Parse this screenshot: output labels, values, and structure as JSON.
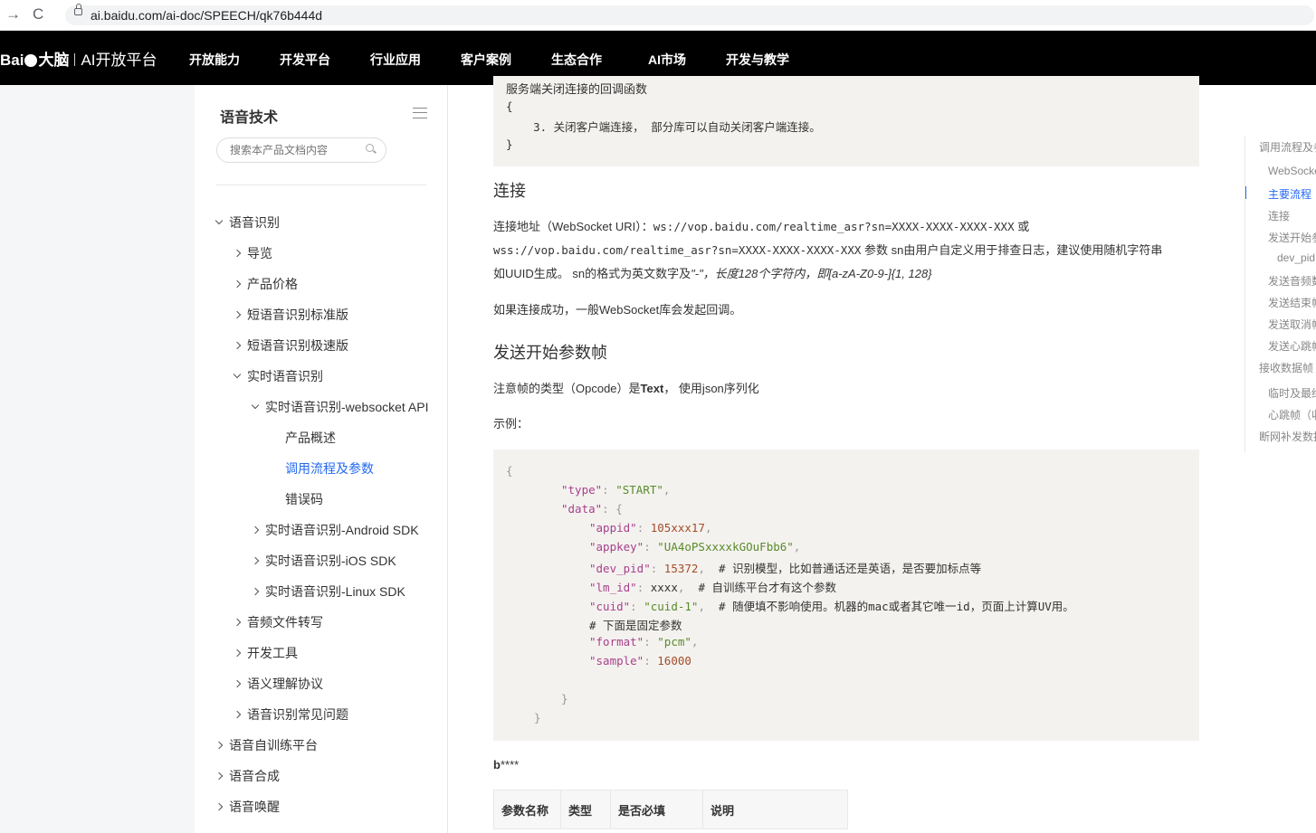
{
  "browser": {
    "url": "ai.baidu.com/ai-doc/SPEECH/qk76b444d",
    "back_icon": "→",
    "reload_icon": "C"
  },
  "topnav": {
    "logo_text": "Bai",
    "logo_text2": "大脑",
    "logo_platform": "AI开放平台",
    "items": [
      "开放能力",
      "开发平台",
      "行业应用",
      "客户案例",
      "生态合作",
      "AI市场",
      "开发与教学"
    ]
  },
  "sidebar": {
    "title": "语音技术",
    "search_placeholder": "搜索本产品文档内容",
    "items": [
      {
        "label": "语音识别"
      },
      {
        "label": "导览"
      },
      {
        "label": "产品价格"
      },
      {
        "label": "短语音识别标准版"
      },
      {
        "label": "短语音识别极速版"
      },
      {
        "label": "实时语音识别"
      },
      {
        "label": "实时语音识别-websocket API"
      },
      {
        "label": "产品概述"
      },
      {
        "label": "调用流程及参数"
      },
      {
        "label": "错误码"
      },
      {
        "label": "实时语音识别-Android SDK"
      },
      {
        "label": "实时语音识别-iOS SDK"
      },
      {
        "label": "实时语音识别-Linux SDK"
      },
      {
        "label": "音频文件转写"
      },
      {
        "label": "开发工具"
      },
      {
        "label": "语义理解协议"
      },
      {
        "label": "语音识别常见问题"
      },
      {
        "label": "语音自训练平台"
      },
      {
        "label": "语音合成"
      },
      {
        "label": "语音唤醒"
      }
    ]
  },
  "content": {
    "top_code": {
      "line1": "服务端关闭连接的回调函数",
      "line2": "{",
      "line3": "    3. 关闭客户端连接， 部分库可以自动关闭客户端连接。",
      "line4": "}"
    },
    "h_connect": "连接",
    "connect_p1_a": "连接地址（WebSocket URI）：",
    "connect_p1_code1": "ws://vop.baidu.com/realtime_asr?sn=XXXX-XXXX-XXXX-XXX",
    "connect_p1_b": " 或",
    "connect_p2_code2": "wss://vop.baidu.com/realtime_asr?sn=XXXX-XXXX-XXXX-XXX",
    "connect_p2_c": " 参数 sn由用户自定义用于排查日志，建议使用随机字符串",
    "connect_p3_a": "如UUID生成。 sn的格式为英文数字及",
    "connect_p3_b": "\"-\"，长度128个字符内，即[a-zA-Z0-9-]{1, 128}",
    "connect_success": "如果连接成功，一般WebSocket库会发起回调。",
    "h_start": "发送开始参数帧",
    "start_note_a": "注意帧的类型（Opcode）是",
    "start_note_b": "Text",
    "start_note_c": "， 使用json序列化",
    "example_label": "示例：",
    "json_example": {
      "open": "{",
      "type_key": "\"type\"",
      "type_val": "\"START\"",
      "data_key": "\"data\"",
      "appid_key": "\"appid\"",
      "appid_val": "105xxx17",
      "appkey_key": "\"appkey\"",
      "appkey_val": "\"UA4oPSxxxxkGOuFbb6\"",
      "devpid_key": "\"dev_pid\"",
      "devpid_val": "15372",
      "devpid_comment": "# 识别模型，比如普通话还是英语，是否要加标点等",
      "lmid_key": "\"lm_id\"",
      "lmid_val": "xxxx",
      "lmid_comment": "# 自训练平台才有这个参数",
      "cuid_key": "\"cuid\"",
      "cuid_val": "\"cuid-1\"",
      "cuid_comment": "# 随便填不影响使用。机器的mac或者其它唯一id，页面上计算UV用。",
      "fixed_comment": "# 下面是固定参数",
      "format_key": "\"format\"",
      "format_val": "\"pcm\"",
      "sample_key": "\"sample\"",
      "sample_val": "16000",
      "close_inner": "}",
      "close_outer": "}"
    },
    "b_label": "b",
    "b_stars": "****",
    "table_headers": [
      "参数名称",
      "类型",
      "是否必填",
      "说明"
    ]
  },
  "toc": {
    "items": [
      {
        "label": "调用流程及参"
      },
      {
        "label": "WebSocke"
      },
      {
        "label": "主要流程"
      },
      {
        "label": "连接"
      },
      {
        "label": "发送开始参"
      },
      {
        "label": "dev_pid"
      },
      {
        "label": "发送音频数"
      },
      {
        "label": "发送结束帧"
      },
      {
        "label": "发送取消帧"
      },
      {
        "label": "发送心跳帧"
      },
      {
        "label": "接收数据帧"
      },
      {
        "label": "临时及最终"
      },
      {
        "label": "心跳帧（收"
      },
      {
        "label": "断网补发数据"
      }
    ]
  },
  "colors": {
    "nav_bg": "#000000",
    "accent": "#2468f2",
    "code_bg": "#f4f2ef",
    "sidebar_gutter": "#f5f6f8"
  }
}
